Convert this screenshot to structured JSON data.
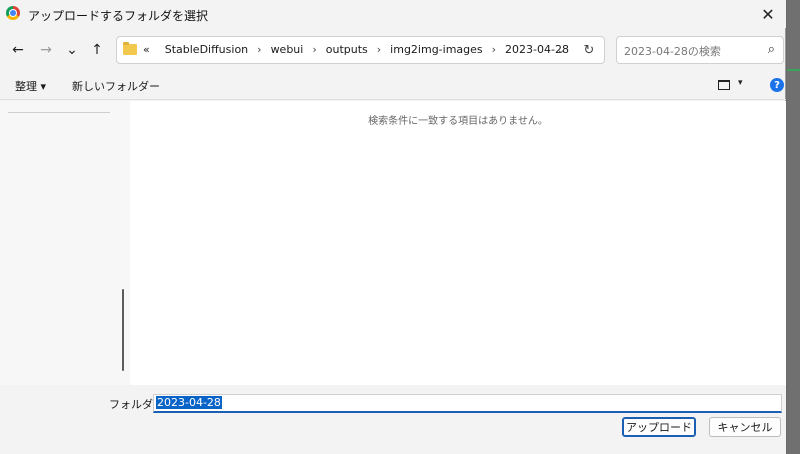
{
  "titlebar": {
    "title": "アップロードするフォルダを選択",
    "close": "✕"
  },
  "nav": {
    "back": "←",
    "forward": "→",
    "recent": "⌄",
    "up": "↑"
  },
  "address": {
    "prefix": "«",
    "crumbs": [
      "StableDiffusion",
      "webui",
      "outputs",
      "img2img-images",
      "2023-04-28"
    ],
    "separator": "›",
    "dropdown": "⌄",
    "refresh": "↻"
  },
  "search": {
    "placeholder": "2023-04-28の検索",
    "icon": "⌕"
  },
  "toolbar": {
    "organize": "整理 ▾",
    "new_folder": "新しいフォルダー",
    "view_dropdown": "▾",
    "help": "?"
  },
  "content": {
    "empty_message": "検索条件に一致する項目はありません。"
  },
  "footer": {
    "folder_label": "フォルダー:",
    "folder_value": "2023-04-28",
    "upload": "アップロード",
    "cancel": "キャンセル"
  },
  "colors": {
    "accent": "#1a5fb4",
    "selection": "#0a64c8",
    "help": "#1a73e8"
  }
}
